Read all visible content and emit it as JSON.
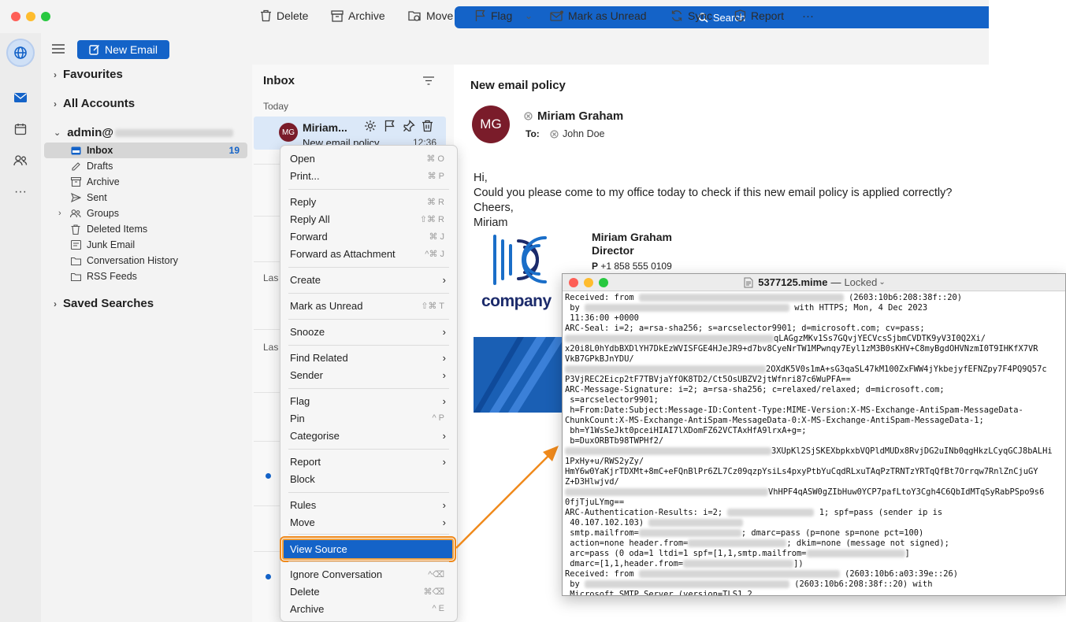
{
  "titlebar": {
    "search_label": "Search"
  },
  "folders": {
    "new_email_label": "New Email",
    "favourites": "Favourites",
    "all_accounts": "All Accounts",
    "account": "admin@",
    "saved_searches": "Saved Searches",
    "items": [
      {
        "label": "Inbox",
        "count": "19",
        "icon": "inbox-icon"
      },
      {
        "label": "Drafts",
        "icon": "drafts-icon"
      },
      {
        "label": "Archive",
        "icon": "archive-icon"
      },
      {
        "label": "Sent",
        "icon": "sent-icon"
      },
      {
        "label": "Groups",
        "icon": "groups-icon"
      },
      {
        "label": "Deleted Items",
        "icon": "trash-icon"
      },
      {
        "label": "Junk Email",
        "icon": "junk-icon"
      },
      {
        "label": "Conversation History",
        "icon": "folder-icon"
      },
      {
        "label": "RSS Feeds",
        "icon": "folder-icon"
      }
    ]
  },
  "toolbar": {
    "delete": "Delete",
    "archive": "Archive",
    "move": "Move",
    "flag": "Flag",
    "mark_unread": "Mark as Unread",
    "sync": "Sync",
    "report": "Report",
    "more": "···"
  },
  "list": {
    "header": "Inbox",
    "group_today": "Today",
    "group_last1": "Las",
    "group_last2": "Las",
    "selected": {
      "initials": "MG",
      "sender": "Miriam...",
      "subject": "New email policy",
      "time": "12:36"
    }
  },
  "reading": {
    "subject": "New email policy",
    "initials": "MG",
    "from": "Miriam Graham",
    "to_label": "To:",
    "to": "John Doe",
    "body": [
      "Hi,",
      "Could you please come to my office today to check if this new email policy is applied correctly?",
      "Cheers,",
      "Miriam"
    ],
    "signature": {
      "name": "Miriam Graham",
      "title": "Director",
      "phone_label": "P",
      "phone": "+1 858 555 0109",
      "company": "company"
    }
  },
  "menu": {
    "items": [
      {
        "label": "Open",
        "shortcut": "⌘ O"
      },
      {
        "label": "Print...",
        "shortcut": "⌘ P"
      },
      {
        "label": "Reply",
        "shortcut": "⌘ R"
      },
      {
        "label": "Reply All",
        "shortcut": "⇧⌘ R"
      },
      {
        "label": "Forward",
        "shortcut": "⌘ J"
      },
      {
        "label": "Forward as Attachment",
        "shortcut": "^⌘ J"
      },
      {
        "label": "Create"
      },
      {
        "label": "Mark as Unread",
        "shortcut": "⇧⌘ T"
      },
      {
        "label": "Snooze"
      },
      {
        "label": "Find Related"
      },
      {
        "label": "Sender"
      },
      {
        "label": "Flag"
      },
      {
        "label": "Pin",
        "shortcut": "^ P"
      },
      {
        "label": "Categorise"
      },
      {
        "label": "Report"
      },
      {
        "label": "Block"
      },
      {
        "label": "Rules"
      },
      {
        "label": "Move"
      },
      {
        "label": "View Source"
      },
      {
        "label": "Ignore Conversation",
        "shortcut": "^⌫"
      },
      {
        "label": "Delete",
        "shortcut": "⌘⌫"
      },
      {
        "label": "Archive",
        "shortcut": "^ E"
      }
    ]
  },
  "source_window": {
    "filename": "5377125.mime",
    "status": "Locked",
    "lines": [
      "Received: from ",
      " (2603:10b6:208:38f::20)",
      " by ",
      " with HTTPS; Mon, 4 Dec 2023",
      " 11:36:00 +0000",
      "ARC-Seal: i=2; a=rsa-sha256; s=arcselector9901; d=microsoft.com; cv=pass;",
      "qLAGgzMKv1Ss7GQvjYECVcsSjbmCVDTK9yV3I0Q2Xi/",
      "x20i8L0hYdbBXDlYH7DkEzWVISFGE4HJeJR9+d7bv8CyeNrTW1MPwnqy7Eyl1zM3B0sKHV+C8myBgdOHVNzmI0T9IHKfX7VR",
      "VkB7GPkBJnYDU/",
      "2OXdK5V0s1mA+sG3qaSL47kM100ZxFWW4jYkbejyfEFNZpy7F4PQ9Q57c",
      "P3VjREC2Eicp2tF7TBVjaYfOK8TD2/Ct5OsUBZV2jtWfnri87c6WuPFA==",
      "ARC-Message-Signature: i=2; a=rsa-sha256; c=relaxed/relaxed; d=microsoft.com;",
      " s=arcselector9901;",
      " h=From:Date:Subject:Message-ID:Content-Type:MIME-Version:X-MS-Exchange-AntiSpam-MessageData-",
      "ChunkCount:X-MS-Exchange-AntiSpam-MessageData-0:X-MS-Exchange-AntiSpam-MessageData-1;",
      " bh=Y1WsSeJkt0pceiHIAI7lXDomFZ62VCTAxHfA9lrxA+g=;",
      " b=DuxORBTb98TWPHf2/",
      "3XUpKl2SjSKEXbpkxbVQPldMUDx8RvjDG2uINb0qgHkzLCyqGCJ8bALHi",
      "1PxHy+u/RWS2yZy/",
      "HmY6w0YaKjrTDXMt+8mC+eFQnBlPr6ZL7Cz09qzpYsiLs4pxyPtbYuCqdRLxuTAqPzTRNTzYRTqQfBt7Orrqw7RnlZnCjuGY",
      "Z+D3Hlwjvd/",
      "VhHPF4qASW0gZIbHuw0YCP7pafLtoY3Cgh4C6QbIdMTqSyRabPSpo9s6",
      "0fjTjuLYmg==",
      "ARC-Authentication-Results: i=2; ",
      " 1; spf=pass (sender ip is",
      " 40.107.102.103) ",
      " smtp.mailfrom=",
      "; dmarc=pass (p=none sp=none pct=100)",
      " action=none header.from=",
      "; dkim=none (message not signed);",
      " arc=pass (0 oda=1 ltdi=1 spf=[1,1,smtp.mailfrom=",
      "]",
      " dmarc=[1,1,header.from=",
      "])",
      "Received: from ",
      " (2603:10b6:a03:39e::26)",
      " by ",
      " (2603:10b6:208:38f::20) with",
      " Microsoft SMTP Server (version=TLS1_2,"
    ]
  },
  "colors": {
    "accent": "#1463c8",
    "highlight": "#f08a1c",
    "avatar": "#7a1c2a"
  }
}
